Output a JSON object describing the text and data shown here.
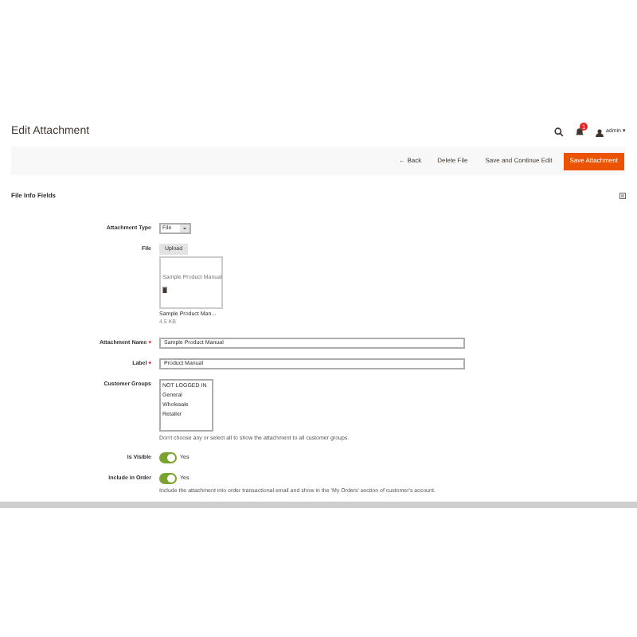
{
  "page_title": "Edit Attachment",
  "header": {
    "notifications": "1",
    "user": "admin",
    "user_caret": "▾"
  },
  "actions": [
    {
      "label": "Back",
      "kind": "back",
      "icon": "←"
    },
    {
      "label": "Delete File",
      "kind": "plain"
    },
    {
      "label": "Save and Continue Edit",
      "kind": "plain"
    },
    {
      "label": "Save Attachment",
      "kind": "primary"
    }
  ],
  "section": {
    "title": "File Info Fields"
  },
  "attachment_type": {
    "label": "Attachment Type",
    "value": "File"
  },
  "file": {
    "label": "File",
    "button": "Upload",
    "preview_text": "Sample Product Manual",
    "file_name": "Sample Product Man...",
    "file_size": "4.5 KB"
  },
  "attachment_name": {
    "label": "Attachment Name",
    "value": "Sample Product Manual",
    "required": true,
    "required_mark": "*"
  },
  "label_field": {
    "label": "Label",
    "value": "Product Manual",
    "required": true,
    "required_mark": "*"
  },
  "customer_groups": {
    "label": "Customer Groups",
    "options": [
      "NOT LOGGED IN",
      "General",
      "Wholesale",
      "Retailer"
    ],
    "note": "Don't choose any or select all to show the attachment to all customer groups."
  },
  "is_visible": {
    "label": "Is Visible",
    "on": true,
    "text": "Yes"
  },
  "include_in_order": {
    "label": "Include in Order",
    "on": true,
    "text": "Yes",
    "note": "Include the attachment into order transactional email and show in the 'My Orders' section of customer's account."
  }
}
